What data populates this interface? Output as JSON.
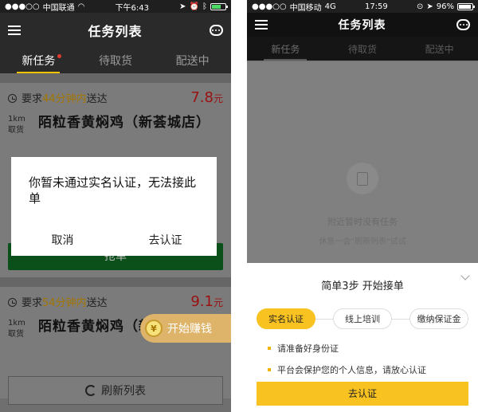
{
  "left": {
    "status": {
      "carrier": "中国联通",
      "time": "下午6:43"
    },
    "nav": {
      "title": "任务列表"
    },
    "tabs": [
      "新任务",
      "待取货",
      "配送中"
    ],
    "cards": [
      {
        "prefix": "要求",
        "minutes": "44分钟内",
        "suffix": "送达",
        "price": "7.8",
        "unit": "元",
        "distance": "1km",
        "dist_label": "取货",
        "address": "陌粒香黄焖鸡（新荟城店）"
      },
      {
        "prefix": "要求",
        "minutes": "54分钟内",
        "suffix": "送达",
        "price": "9.1",
        "unit": "元",
        "distance": "1km",
        "dist_label": "取货",
        "address": "陌粒香黄焖鸡（新荟城店）"
      }
    ],
    "grab_label": "抢单",
    "earn_label": "开始赚钱",
    "coin_symbol": "¥",
    "refresh_label": "刷新列表",
    "dialog": {
      "message": "你暂未通过实名认证，无法接此单",
      "cancel": "取消",
      "confirm": "去认证"
    }
  },
  "right": {
    "status": {
      "carrier": "中国移动",
      "network": "4G",
      "time": "17:59",
      "battery": "96%"
    },
    "nav": {
      "title": "任务列表"
    },
    "tabs": [
      "新任务",
      "待取货",
      "配送中"
    ],
    "empty": {
      "text": "附近暂时没有任务",
      "hint": "休息一会\"刷新列表\"试试"
    },
    "sheet": {
      "title": "简单3步 开始接单",
      "steps": [
        "实名认证",
        "线上培训",
        "缴纳保证金"
      ],
      "tips": [
        "请准备好身份证",
        "平台会保护您的个人信息，请放心认证"
      ],
      "button": "去认证"
    }
  }
}
